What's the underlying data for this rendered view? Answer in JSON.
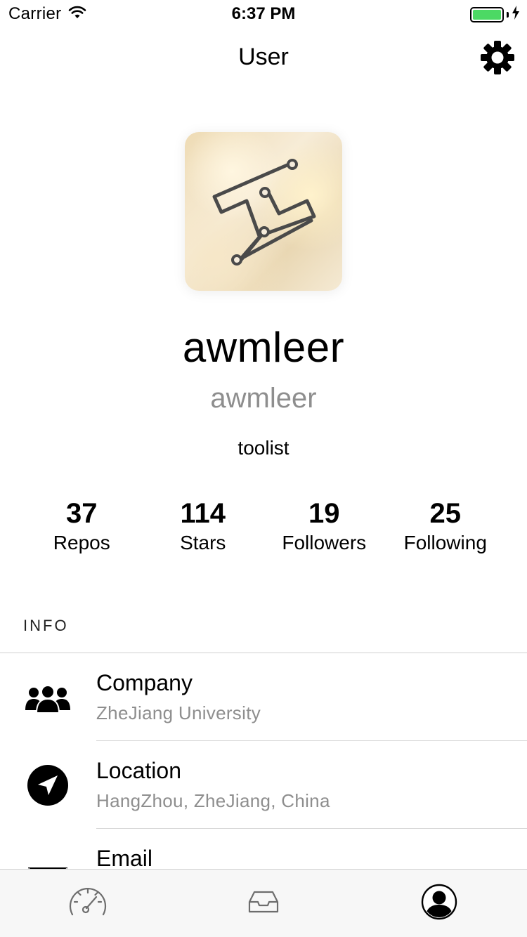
{
  "status_bar": {
    "carrier": "Carrier",
    "time": "6:37 PM",
    "battery_level": 1.0,
    "battery_color": "#4cd964"
  },
  "nav": {
    "title": "User",
    "settings_icon": "gear-icon"
  },
  "profile": {
    "display_name": "awmleer",
    "login": "awmleer",
    "bio": "toolist"
  },
  "stats": [
    {
      "value": "37",
      "label": "Repos"
    },
    {
      "value": "114",
      "label": "Stars"
    },
    {
      "value": "19",
      "label": "Followers"
    },
    {
      "value": "25",
      "label": "Following"
    }
  ],
  "info": {
    "header": "INFO",
    "rows": [
      {
        "title": "Company",
        "value": "ZheJiang University",
        "icon": "people-icon"
      },
      {
        "title": "Location",
        "value": "HangZhou, ZheJiang, China",
        "icon": "location-arrow-icon"
      },
      {
        "title": "Email",
        "value": "",
        "icon": "envelope-icon"
      }
    ]
  },
  "tabs": [
    {
      "name": "dashboard",
      "icon": "speedometer-icon",
      "active": false
    },
    {
      "name": "inbox",
      "icon": "inbox-tray-icon",
      "active": false
    },
    {
      "name": "user",
      "icon": "user-avatar-icon",
      "active": true
    }
  ],
  "colors": {
    "secondary_text": "#8e8e8e",
    "tab_inactive": "#6d6d6d",
    "tab_active": "#000000"
  }
}
